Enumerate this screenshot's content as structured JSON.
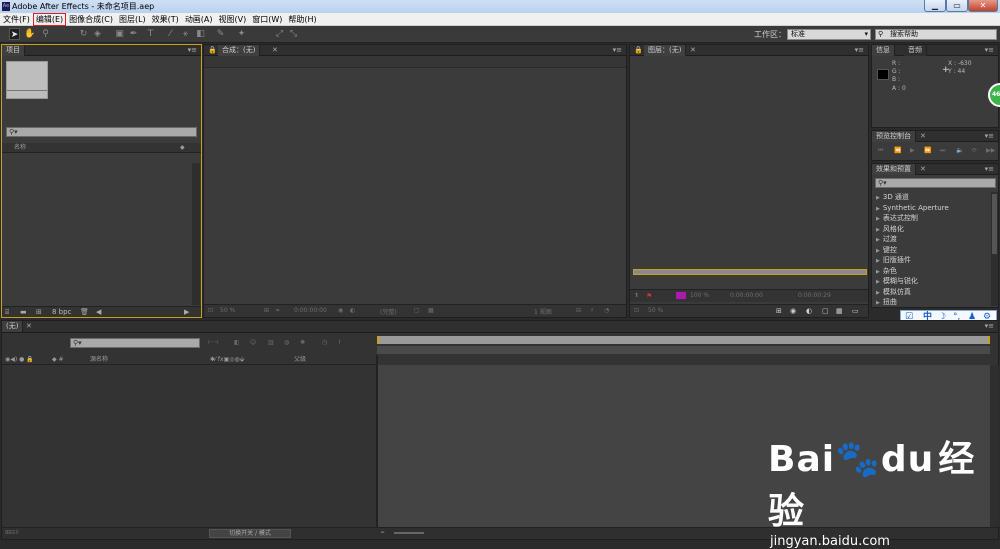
{
  "window": {
    "title": "Adobe After Effects - 未命名项目.aep",
    "app_icon": "Ae"
  },
  "menu": [
    {
      "label": "文件(F)"
    },
    {
      "label": "编辑(E)"
    },
    {
      "label": "图像合成(C)"
    },
    {
      "label": "图层(L)"
    },
    {
      "label": "效果(T)"
    },
    {
      "label": "动画(A)"
    },
    {
      "label": "视图(V)"
    },
    {
      "label": "窗口(W)"
    },
    {
      "label": "帮助(H)"
    }
  ],
  "toolbar": {
    "workspace_label": "工作区：",
    "workspace_value": "标准",
    "search_placeholder": "搜索帮助"
  },
  "project_panel": {
    "tab": "项目",
    "col_name": "名称",
    "bpc": "8 bpc"
  },
  "composition_panel": {
    "tab": "合成：(无)",
    "zoom": "50 %",
    "timecode": "0:00:00:00",
    "resolution": "(完整)",
    "view": "1 视图"
  },
  "layer_panel": {
    "tab": "图层：(无)",
    "zoom": "50 %",
    "t_in": "0:00:00:00",
    "t_out": "0:00:00:29",
    "pct": "100 %"
  },
  "info_panel": {
    "tabs": [
      "信息",
      "音频"
    ],
    "r": "R :",
    "g": "G :",
    "b": "B :",
    "a": "A : 0",
    "x": "X : -630",
    "y": "Y : 44"
  },
  "preview_panel": {
    "tab": "预览控制台"
  },
  "effects_panel": {
    "tab": "效果和预置",
    "items": [
      "3D 通道",
      "Synthetic Aperture",
      "表达式控制",
      "风格化",
      "过渡",
      "键控",
      "旧版插件",
      "杂色",
      "模糊与锐化",
      "模拟仿真",
      "扭曲"
    ]
  },
  "timeline": {
    "tab": "(无)",
    "col_layer_name": "源名称",
    "col_parent": "父级",
    "footer_toggle": "切换开关 / 模式"
  },
  "ime_bar": {
    "mode": "中"
  },
  "badge": {
    "value": "46"
  },
  "watermark": {
    "brand_1": "Bai",
    "brand_2": "du",
    "brand_cn": "经验",
    "url": "jingyan.baidu.com"
  },
  "colors": {
    "panel": "#3b3b3b",
    "dark": "#2b2b2b",
    "accent_gold": "#c8a020",
    "menu_bg": "#f0f0f0"
  }
}
